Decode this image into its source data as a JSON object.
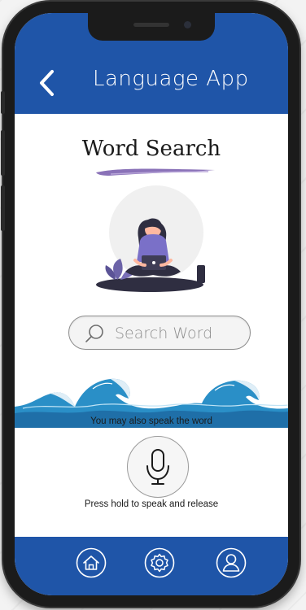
{
  "header": {
    "title": "Language App",
    "back_icon": "chevron-left-icon"
  },
  "main": {
    "heading": "Word Search",
    "illustration": "person-with-laptop-illustration",
    "search": {
      "placeholder": "Search Word",
      "value": "",
      "icon": "search-icon"
    },
    "speak_hint": "You may also speak the word",
    "mic_icon": "microphone-icon",
    "hold_hint": "Press hold to speak and release"
  },
  "bottom_nav": {
    "items": [
      {
        "icon": "home-icon"
      },
      {
        "icon": "gear-icon"
      },
      {
        "icon": "user-icon"
      }
    ]
  },
  "colors": {
    "primary": "#1f55a8",
    "brush": "#8a72b8",
    "wave": "#2a8fc7"
  }
}
